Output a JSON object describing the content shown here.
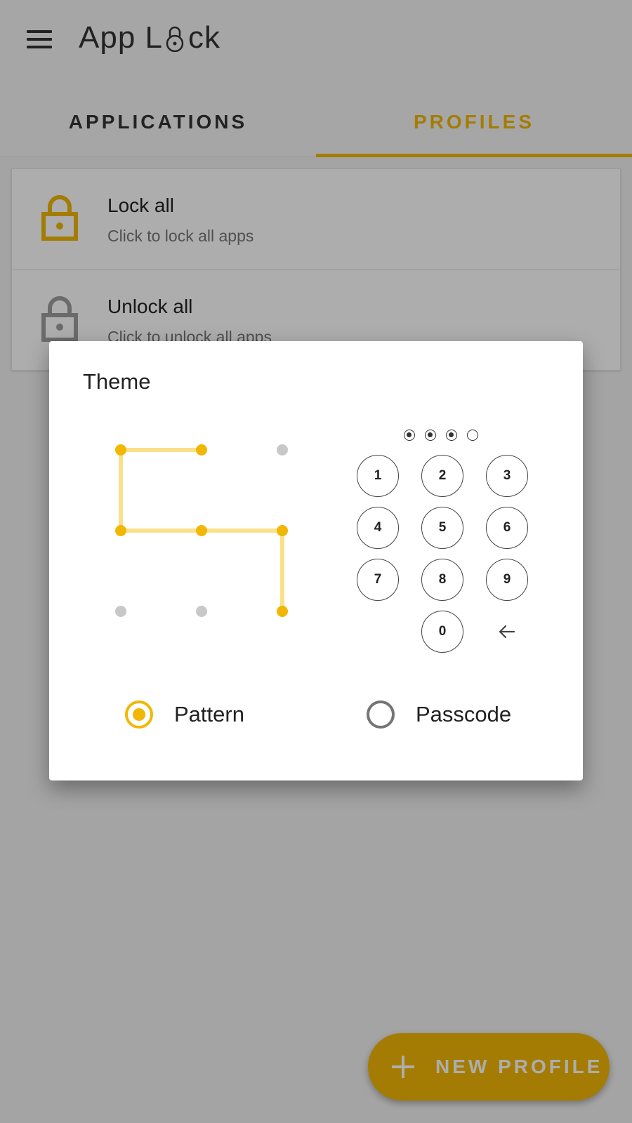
{
  "app": {
    "title_prefix": "App L",
    "title_suffix": "ck",
    "menu_icon": "hamburger-menu-icon"
  },
  "tabs": [
    {
      "label": "APPLICATIONS",
      "active": false
    },
    {
      "label": "PROFILES",
      "active": true
    }
  ],
  "list": [
    {
      "title": "Lock all",
      "subtitle": "Click to lock all apps",
      "icon": "lock-icon",
      "color": "#f2b705"
    },
    {
      "title": "Unlock all",
      "subtitle": "Click to unlock all apps",
      "icon": "unlock-icon",
      "color": "#9e9e9e"
    }
  ],
  "fab": {
    "label": "NEW PROFILE",
    "icon": "plus-icon"
  },
  "dialog": {
    "title": "Theme",
    "pin_indicator": {
      "filled": 3,
      "total": 4
    },
    "keypad_keys": [
      "1",
      "2",
      "3",
      "4",
      "5",
      "6",
      "7",
      "8",
      "9",
      "0"
    ],
    "backspace_icon": "backspace-arrow-icon",
    "options": [
      {
        "label": "Pattern",
        "selected": true
      },
      {
        "label": "Passcode",
        "selected": false
      }
    ]
  },
  "colors": {
    "accent": "#f2b705",
    "accent_light": "#fbe08a",
    "inactive_dot": "#c8c8c8",
    "scrim": "rgba(0,0,0,0.32)"
  }
}
